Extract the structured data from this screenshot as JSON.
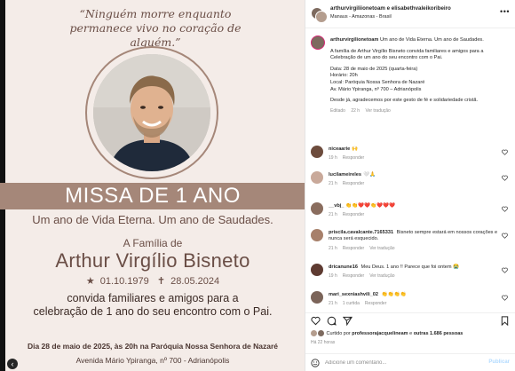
{
  "post": {
    "quote": "“Ninguém morre enquanto permanece vivo no coração de alguém.”",
    "banner": "MISSA DE 1 ANO",
    "subbanner": "Um ano de Vida Eterna. Um ano de Saudades.",
    "family_intro": "A Família de",
    "name": "Arthur Virgílio Bisneto",
    "birth_date": "01.10.1979",
    "death_date": "28.05.2024",
    "invite_line1": "convida familiares e amigos para a",
    "invite_line2": "celebração de 1 ano do seu encontro com o Pai.",
    "event": "Dia 28 de maio de 2025, às 20h na Paróquia Nossa Senhora de Nazaré",
    "address": "Avenida Mário Ypiranga, nº 700 - Adrianópolis",
    "colors": {
      "accent": "#a58779",
      "text": "#6a4e46",
      "background": "#f4ece8"
    }
  },
  "header": {
    "names": "arthurvirgiliionetoam e elisabethvaleikoribeiro",
    "location": "Manaus - Amazonas - Brasil",
    "more_icon": "more-dots-icon"
  },
  "caption": {
    "username": "arthurvirgilionetoam",
    "first_line": "Um ano de Vida Eterna. Um ano de Saudades.",
    "lines": [
      "A família de Arthur Virgílio Bisneto convida familiares e amigos para a Celebração de um ano do seu encontro com o Pai.",
      "Data: 28 de maio de 2025 (quarta-feira)",
      "Horário: 20h",
      "Local: Paróquia Nossa Senhora de Nazaré",
      "Av. Mário Ypiranga, nº 700 – Adrianópolis",
      "Desde já, agradecemos por este gesto de fé e solidariedade cristã."
    ],
    "edited": "Editado",
    "time": "22 h",
    "translate": "Ver tradução"
  },
  "comments": [
    {
      "user": "niceaarie",
      "text": "🙌",
      "time": "19 h",
      "reply": "Responder",
      "translate": ""
    },
    {
      "user": "lucilameireles",
      "text": "🤍🙏",
      "time": "21 h",
      "reply": "Responder",
      "translate": ""
    },
    {
      "user": "__vbj_",
      "text": "👏👏❤️❤️👏❤️❤️❤️",
      "time": "21 h",
      "reply": "Responder",
      "translate": ""
    },
    {
      "user": "priscila.cavalcante.7165331",
      "text": "Bisneto sempre estará em nossos corações e nunca será esquecido.",
      "time": "21 h",
      "reply": "Responder",
      "translate": "Ver tradução"
    },
    {
      "user": "dricanune16",
      "text": "Meu Deus. 1 ano !! Parece que foi ontem 😭",
      "time": "19 h",
      "reply": "Responder",
      "translate": "Ver tradução"
    },
    {
      "user": "mari_sexniashvili_02",
      "text": "👏👏👏👏",
      "time": "21 h",
      "reply": "Responder",
      "likes": "1 curtida",
      "translate": ""
    }
  ],
  "likes": {
    "prefix": "Curtido por",
    "user": "professorajacquelineam",
    "middle": "e",
    "others": "outras 1.686 pessoas"
  },
  "post_time": "Há 22 horas",
  "comment_box": {
    "placeholder": "Adicione um comentário...",
    "publish_label": "Publicar"
  }
}
